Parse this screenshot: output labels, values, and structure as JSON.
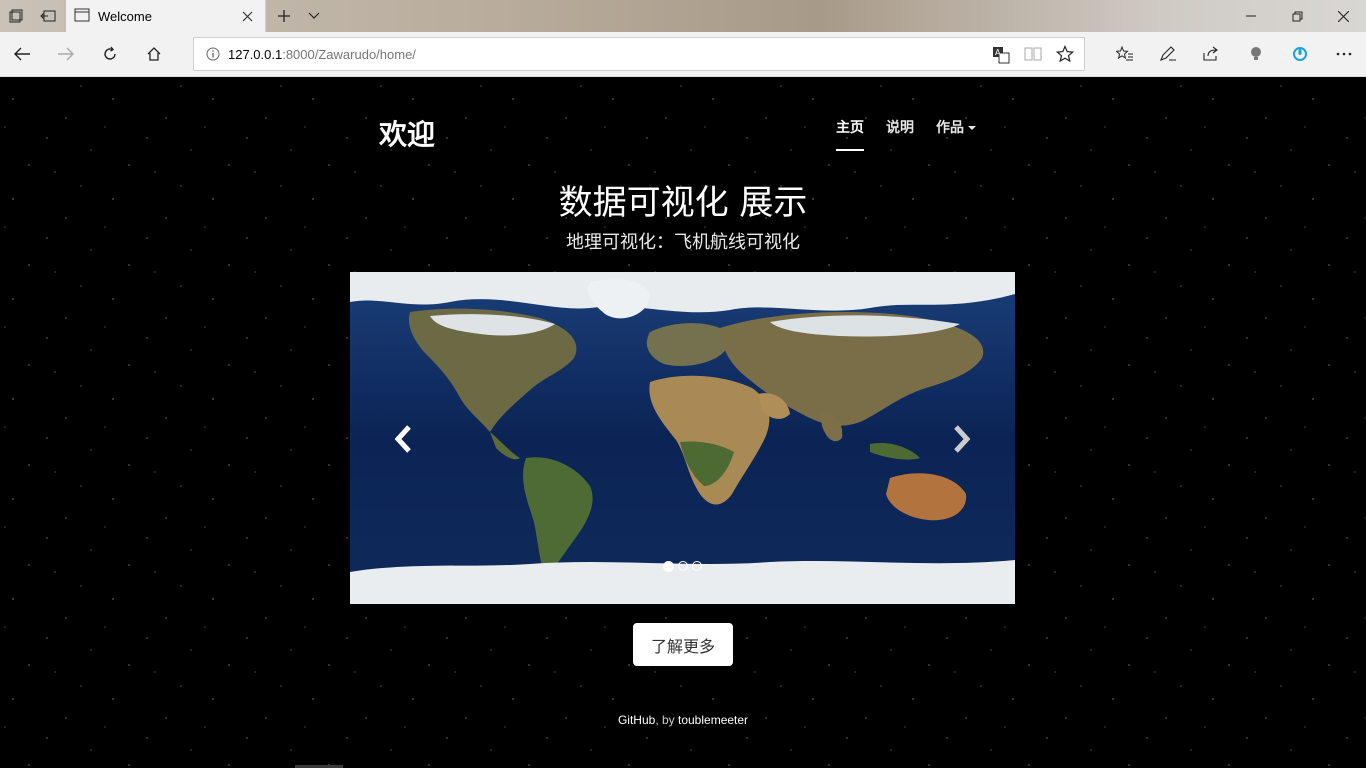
{
  "browser": {
    "tab_title": "Welcome",
    "url_host": "127.0.0.1",
    "url_path": ":8000/Zawarudo/home/"
  },
  "site": {
    "brand": "欢迎",
    "nav": [
      {
        "label": "主页",
        "active": true
      },
      {
        "label": "说明",
        "active": false
      },
      {
        "label": "作品",
        "active": false,
        "dropdown": true
      }
    ],
    "headline": "数据可视化 展示",
    "subline": "地理可视化：飞机航线可视化",
    "carousel": {
      "slide_count": 3,
      "active_index": 0,
      "image": "world-map-satellite"
    },
    "cta_label": "了解更多",
    "footer": {
      "link1": "GitHub",
      "sep": ", by ",
      "link2": "toublemeeter"
    }
  },
  "colors": {
    "page_bg": "#000000",
    "chrome_bg": "#f2f2f2",
    "ocean": "#0d2a5c",
    "land": "#6a5a3a",
    "ice": "#e8ecef"
  }
}
